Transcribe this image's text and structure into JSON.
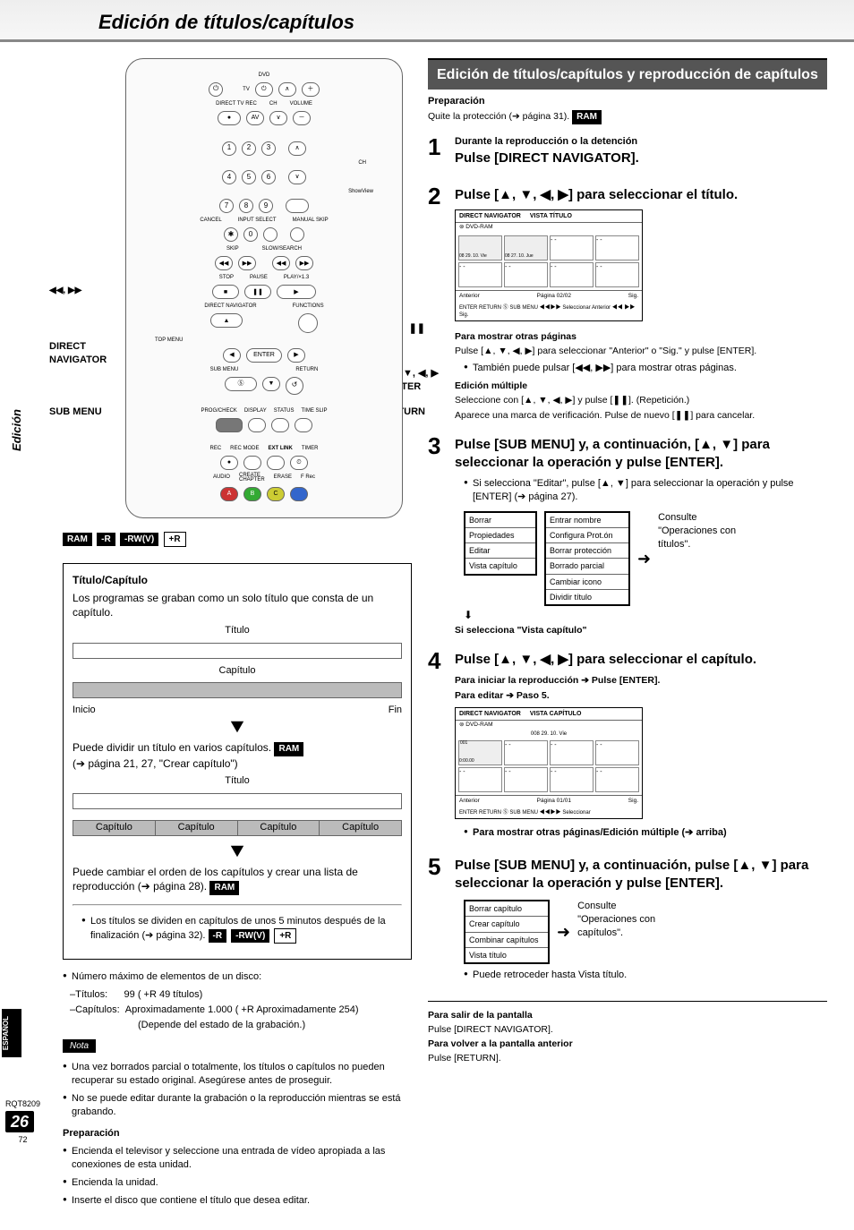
{
  "header": {
    "title": "Edición de títulos/capítulos"
  },
  "sidebar": {
    "tab": "Edición",
    "lang": "ESPAÑOL",
    "doc": "RQT8209",
    "page": "26",
    "sub": "72"
  },
  "remote": {
    "labels": {
      "skip": "◀◀, ▶▶",
      "direct_nav": "DIRECT\nNAVIGATOR",
      "sub_menu": "SUB MENU",
      "pause": "❚❚",
      "arrows_enter": "▲, ▼, ◀, ▶\nENTER",
      "return": "RETURN"
    },
    "tiny": {
      "dvd": "DVD",
      "tv": "TV",
      "ch": "CH",
      "vol": "VOLUME",
      "direct_tv_rec": "DIRECT TV REC",
      "av": "AV",
      "cancel": "CANCEL",
      "input": "INPUT SELECT",
      "mskip": "MANUAL SKIP",
      "showview": "ShowView",
      "skip": "SKIP",
      "slow": "SLOW/SEARCH",
      "stop": "STOP",
      "pause": "PAUSE",
      "play": "PLAY/×1.3",
      "dnav": "DIRECT NAVIGATOR",
      "func": "FUNCTIONS",
      "topmenu": "TOP MENU",
      "enter": "ENTER",
      "submenu": "SUB MENU",
      "return": "RETURN",
      "prog": "PROG/CHECK",
      "display": "DISPLAY",
      "status": "STATUS",
      "timeslip": "TIME SLIP",
      "rec": "REC",
      "recmode": "REC MODE",
      "extlink": "EXT LINK",
      "timer": "TIMER",
      "audio": "AUDIO",
      "create": "CREATE\nCHAPTER",
      "erase": "ERASE",
      "frec": "F Rec",
      "a": "A",
      "b": "B",
      "c": "C"
    }
  },
  "badges": {
    "ram": "RAM",
    "r": "-R",
    "rwv": "-RW(V)",
    "pr": "+R"
  },
  "left": {
    "box": {
      "title": "Título/Capítulo",
      "intro": "Los programas se graban como un solo título que consta de un capítulo.",
      "titulo": "Título",
      "capitulo": "Capítulo",
      "inicio": "Inicio",
      "fin": "Fin",
      "split": "Puede dividir un título en varios capítulos. ",
      "split_ref": "(➔ página 21, 27, \"Crear capítulo\")",
      "reorder": "Puede cambiar el orden de los capítulos y crear una lista de reproducción (➔ página 28). ",
      "five_min": "Los títulos se dividen en capítulos de unos 5 minutos después de la finalización (➔ página 32). "
    },
    "max_line": "Número máximo de elementos de un disco:",
    "titulos_label": "–Títulos:",
    "titulos_val": "99 ( +R  49 títulos)",
    "capitulos_label": "–Capítulos:",
    "capitulos_val1": "Aproximadamente 1.000 ( +R  Aproximadamente 254)",
    "capitulos_val2": "(Depende del estado de la grabación.)",
    "nota": "Nota",
    "note1": "Una vez borrados parcial o totalmente, los títulos o capítulos no pueden recuperar su estado original. Asegúrese antes de proseguir.",
    "note2": "No se puede editar durante la grabación o la reproducción mientras se está grabando.",
    "prep_title": "Preparación",
    "prep1": "Encienda el televisor y seleccione una entrada de vídeo apropiada a las conexiones de esta unidad.",
    "prep2": "Encienda la unidad.",
    "prep3": "Inserte el disco que contiene el título que desea editar."
  },
  "right": {
    "section": "Edición de títulos/capítulos y reproducción de capítulos",
    "prep_title": "Preparación",
    "prep_text": "Quite la protección (➔ página 31). ",
    "step1_cond": "Durante la reproducción o la detención",
    "step1_head": "Pulse [DIRECT NAVIGATOR].",
    "step2_head": "Pulse [▲, ▼, ◀, ▶] para seleccionar el título.",
    "screen1": {
      "hdr1": "DIRECT NAVIGATOR",
      "hdr2": "VISTA TÍTULO",
      "media": "DVD-RAM",
      "thumb1_date": "08 29. 10. Vie",
      "thumb2_date": "08 27. 10. Jue",
      "ftr_prev": "Anterior",
      "ftr_page": "Página 02/02",
      "ftr_next": "Sig.",
      "help": "ENTER RETURN   Ⓢ SUB MENU   ◀◀▶▶ Seleccionar   Anterior ◀◀ ▶▶ Sig."
    },
    "other_pages_title": "Para mostrar otras páginas",
    "other_pages_1": "Pulse [▲, ▼, ◀, ▶] para seleccionar \"Anterior\" o \"Sig.\" y pulse [ENTER].",
    "other_pages_2": "También puede pulsar [◀◀, ▶▶] para mostrar otras páginas.",
    "multi_title": "Edición múltiple",
    "multi_1": "Seleccione con [▲, ▼, ◀, ▶] y pulse [❚❚]. (Repetición.)",
    "multi_2": "Aparece una marca de verificación. Pulse de nuevo [❚❚] para cancelar.",
    "step3_head": "Pulse [SUB MENU] y, a continuación, [▲, ▼] para seleccionar la operación y pulse [ENTER].",
    "step3_note": "Si selecciona \"Editar\", pulse [▲, ▼] para seleccionar la operación y pulse [ENTER] (➔ página 27).",
    "menus": {
      "left": [
        "Borrar",
        "Propiedades",
        "Editar",
        "Vista capítulo"
      ],
      "right": [
        "Entrar nombre",
        "Configura Prot.ón",
        "Borrar protección",
        "Borrado parcial",
        "Cambiar icono",
        "Dividir título"
      ]
    },
    "consult_titles": "Consulte \"Operaciones con títulos\".",
    "vista_cap_note": "Si selecciona \"Vista capítulo\"",
    "step4_head": "Pulse [▲, ▼, ◀, ▶] para seleccionar el capítulo.",
    "step4_a": "Para iniciar la reproducción ➔ Pulse [ENTER].",
    "step4_b": "Para editar ➔ Paso 5.",
    "screen2": {
      "hdr1": "DIRECT NAVIGATOR",
      "hdr2": "VISTA CAPÍTULO",
      "media": "DVD-RAM",
      "title": "008   29. 10. Vie",
      "time": "0:00.00",
      "ftr_prev": "Anterior",
      "ftr_page": "Página 01/01",
      "ftr_next": "Sig.",
      "help": "ENTER RETURN   Ⓢ SUB MENU   ◀◀▶▶ Seleccionar"
    },
    "other_edit_ref": "Para mostrar otras páginas/Edición múltiple (➔ arriba)",
    "step5_head": "Pulse [SUB MENU] y, a continuación, pulse [▲, ▼] para seleccionar la operación y pulse [ENTER].",
    "chap_menu": [
      "Borrar capítulo",
      "Crear capítulo",
      "Combinar capítulos",
      "Vista título"
    ],
    "consult_chap": "Consulte \"Operaciones con capítulos\".",
    "back_note": "Puede retroceder hasta Vista título.",
    "footer": {
      "exit_t": "Para salir de la pantalla",
      "exit_b": "Pulse [DIRECT NAVIGATOR].",
      "prev_t": "Para volver a la pantalla anterior",
      "prev_b": "Pulse [RETURN]."
    }
  }
}
